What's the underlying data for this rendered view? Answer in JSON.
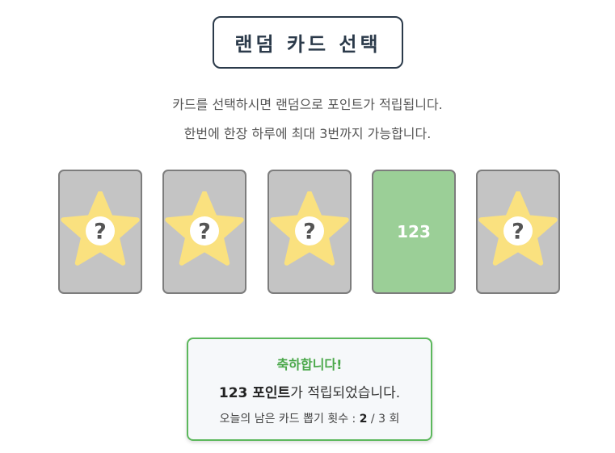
{
  "header": {
    "title": "랜덤 카드 선택"
  },
  "description": {
    "line1": "카드를 선택하시면 랜덤으로 포인트가 적립됩니다.",
    "line2": "한번에 한장 하루에 최대 3번까지 가능합니다."
  },
  "cards": [
    {
      "state": "hidden",
      "icon": "star-question-icon",
      "value": ""
    },
    {
      "state": "hidden",
      "icon": "star-question-icon",
      "value": ""
    },
    {
      "state": "hidden",
      "icon": "star-question-icon",
      "value": ""
    },
    {
      "state": "revealed",
      "icon": "",
      "value": "123"
    },
    {
      "state": "hidden",
      "icon": "star-question-icon",
      "value": ""
    }
  ],
  "result": {
    "congrats": "축하합니다!",
    "points_value": "123 포인트",
    "points_suffix": "가 적립되었습니다.",
    "remaining_prefix": "오늘의 남은 카드 뽑기 횟수 : ",
    "remaining_used": "2",
    "remaining_sep": " / ",
    "remaining_total": "3",
    "remaining_unit": " 회"
  },
  "colors": {
    "card_back": "#c4c4c4",
    "card_revealed": "#9bcf97",
    "star": "#fae17f",
    "accent_green": "#5cb85c",
    "title_border": "#2b3a4a"
  }
}
